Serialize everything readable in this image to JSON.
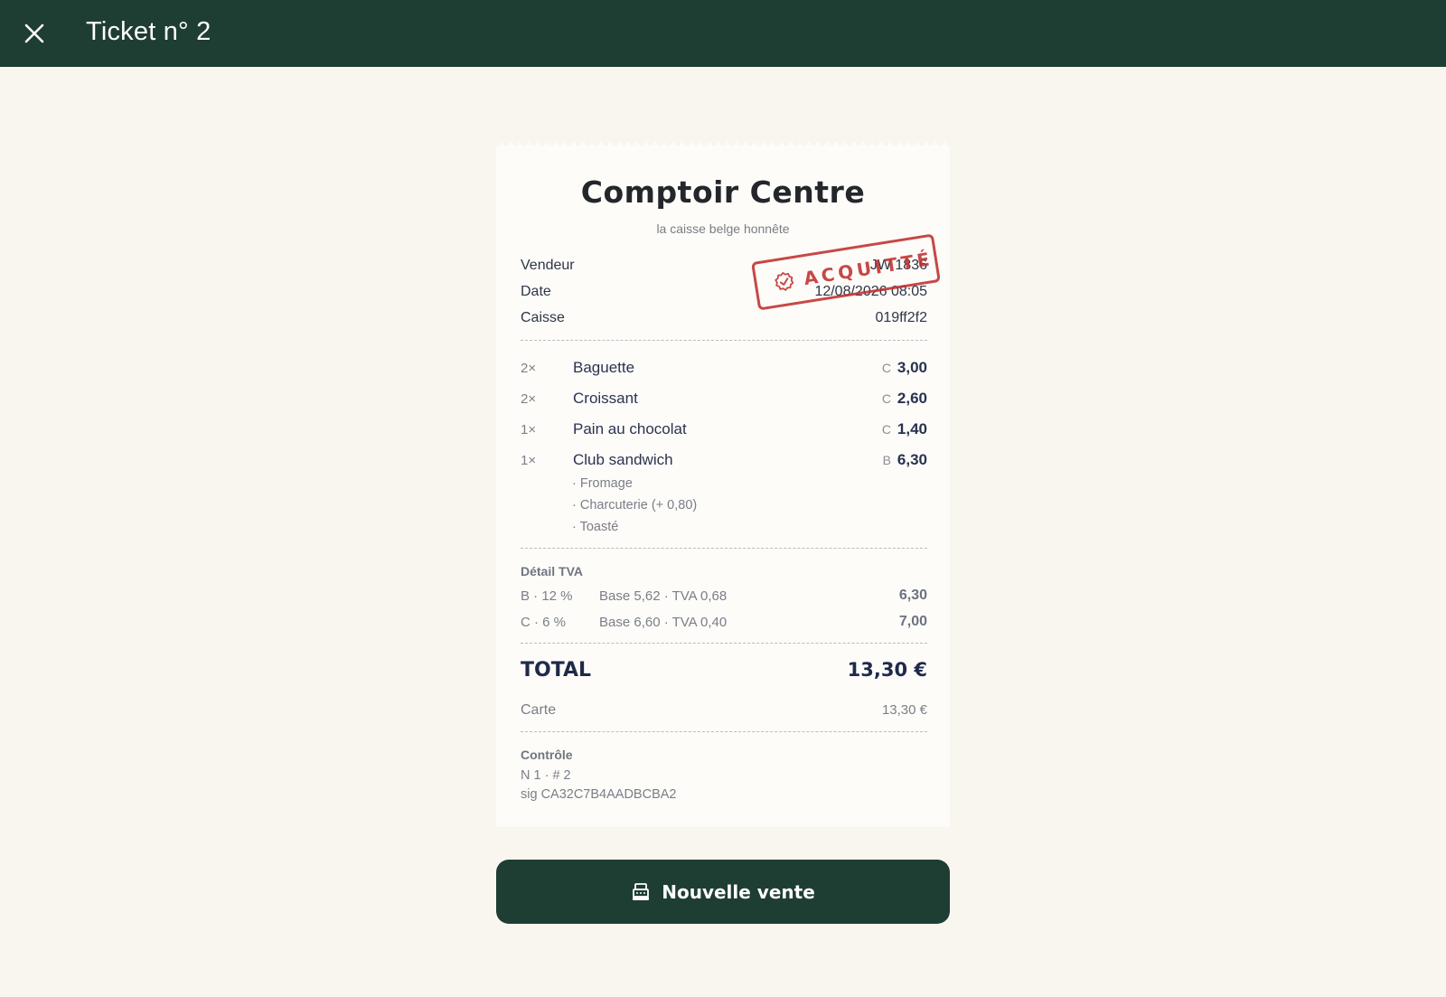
{
  "header": {
    "title": "Ticket n° 2",
    "close_icon": "close-icon"
  },
  "receipt": {
    "store_name": "Comptoir Centre",
    "tagline": "la caisse belge honnête",
    "meta": [
      {
        "label": "Vendeur",
        "value": "JW 1836"
      },
      {
        "label": "Date",
        "value": "12/08/2026 08:05"
      },
      {
        "label": "Caisse",
        "value": "019ff2f2"
      }
    ],
    "stamp": {
      "text": "ACQUITTÉ",
      "icon": "check-badge-icon",
      "color": "#c0302e"
    },
    "items": [
      {
        "qty": "2×",
        "name": "Baguette",
        "vat_code": "C",
        "price": "3,00"
      },
      {
        "qty": "2×",
        "name": "Croissant",
        "vat_code": "C",
        "price": "2,60"
      },
      {
        "qty": "1×",
        "name": "Pain au chocolat",
        "vat_code": "C",
        "price": "1,40"
      },
      {
        "qty": "1×",
        "name": "Club sandwich",
        "vat_code": "B",
        "price": "6,30",
        "options": [
          "· Fromage",
          "· Charcuterie (+ 0,80)",
          "· Toasté"
        ]
      }
    ],
    "vat": {
      "label": "Détail TVA",
      "rows": [
        {
          "rate": "B · 12 %",
          "detail": "Base 5,62  ·  TVA 0,68",
          "amount": "6,30"
        },
        {
          "rate": "C · 6 %",
          "detail": "Base 6,60  ·  TVA 0,40",
          "amount": "7,00"
        }
      ]
    },
    "total": {
      "label": "TOTAL",
      "value": "13,30 €"
    },
    "payment": {
      "method": "Carte",
      "amount": "13,30 €"
    },
    "control": {
      "label": "Contrôle",
      "line1": "N 1  ·  # 2",
      "line2": "sig CA32C7B4AADBCBA2"
    }
  },
  "actions": {
    "new_sale_label": "Nouvelle vente",
    "new_sale_icon": "cash-register-icon"
  },
  "colors": {
    "topbar": "#1e3d33",
    "background": "#f9f6ef",
    "stamp": "#c0302e"
  }
}
